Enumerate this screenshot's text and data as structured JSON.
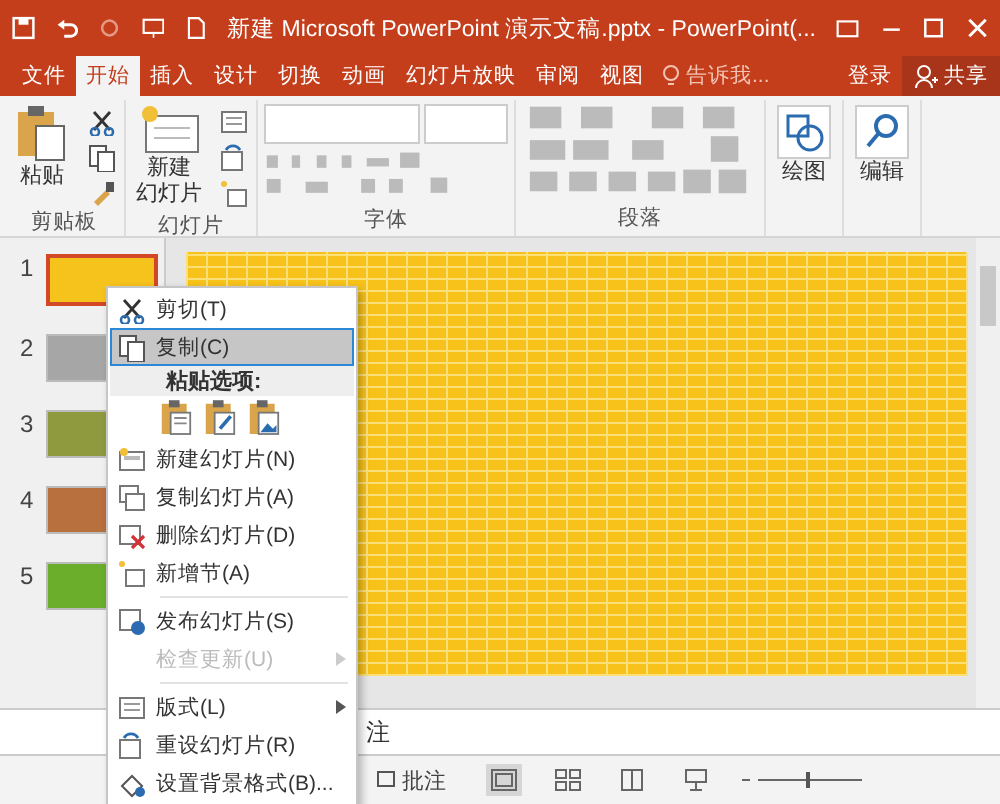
{
  "window": {
    "title": "新建 Microsoft PowerPoint 演示文稿.pptx - PowerPoint(..."
  },
  "tabs": [
    {
      "label": "文件",
      "selected": false
    },
    {
      "label": "开始",
      "selected": true
    },
    {
      "label": "插入",
      "selected": false
    },
    {
      "label": "设计",
      "selected": false
    },
    {
      "label": "切换",
      "selected": false
    },
    {
      "label": "动画",
      "selected": false
    },
    {
      "label": "幻灯片放映",
      "selected": false
    },
    {
      "label": "审阅",
      "selected": false
    },
    {
      "label": "视图",
      "selected": false
    }
  ],
  "tell_me": "告诉我...",
  "sign_in": "登录",
  "share": "共享",
  "ribbon": {
    "groups": [
      {
        "kind": "clipboard",
        "label": "剪贴板",
        "button": [
          "粘贴"
        ]
      },
      {
        "kind": "slides",
        "label": "幻灯片",
        "button": [
          "新建",
          "幻灯片"
        ]
      },
      {
        "kind": "font",
        "label": "字体"
      },
      {
        "kind": "paragraph",
        "label": "段落"
      },
      {
        "kind": "drawing",
        "button": [
          "绘图"
        ]
      },
      {
        "kind": "editing",
        "button": [
          "编辑"
        ]
      }
    ]
  },
  "slides": [
    {
      "number": "1",
      "color": "#f6c21c",
      "selected": true
    },
    {
      "number": "2",
      "color": "#a6a6a6",
      "selected": false
    },
    {
      "number": "3",
      "color": "#8f9a3e",
      "selected": false
    },
    {
      "number": "4",
      "color": "#b8703e",
      "selected": false
    },
    {
      "number": "5",
      "color": "#6aae2c",
      "selected": false
    }
  ],
  "context_menu": {
    "items": [
      {
        "kind": "item",
        "label": "剪切(T)",
        "selected": false,
        "disabled": false,
        "submenu": false
      },
      {
        "kind": "item",
        "label": "复制(C)",
        "selected": true,
        "disabled": false,
        "submenu": false
      },
      {
        "kind": "header",
        "label": "粘贴选项:"
      },
      {
        "kind": "paste_options"
      },
      {
        "kind": "item",
        "label": "新建幻灯片(N)",
        "selected": false,
        "disabled": false,
        "submenu": false
      },
      {
        "kind": "item",
        "label": "复制幻灯片(A)",
        "selected": false,
        "disabled": false,
        "submenu": false
      },
      {
        "kind": "item",
        "label": "删除幻灯片(D)",
        "selected": false,
        "disabled": false,
        "submenu": false
      },
      {
        "kind": "item",
        "label": "新增节(A)",
        "selected": false,
        "disabled": false,
        "submenu": false
      },
      {
        "kind": "separator"
      },
      {
        "kind": "item",
        "label": "发布幻灯片(S)",
        "selected": false,
        "disabled": false,
        "submenu": false
      },
      {
        "kind": "item",
        "label": "检查更新(U)",
        "selected": false,
        "disabled": true,
        "submenu": true
      },
      {
        "kind": "separator"
      },
      {
        "kind": "item",
        "label": "版式(L)",
        "selected": false,
        "disabled": false,
        "submenu": true
      },
      {
        "kind": "item",
        "label": "重设幻灯片(R)",
        "selected": false,
        "disabled": false,
        "submenu": false
      },
      {
        "kind": "item",
        "label": "设置背景格式(B)...",
        "selected": false,
        "disabled": false,
        "submenu": false
      }
    ]
  },
  "notes": "注",
  "status_bar": {
    "comments": "批注",
    "zoom": {
      "level": 0.5
    }
  }
}
